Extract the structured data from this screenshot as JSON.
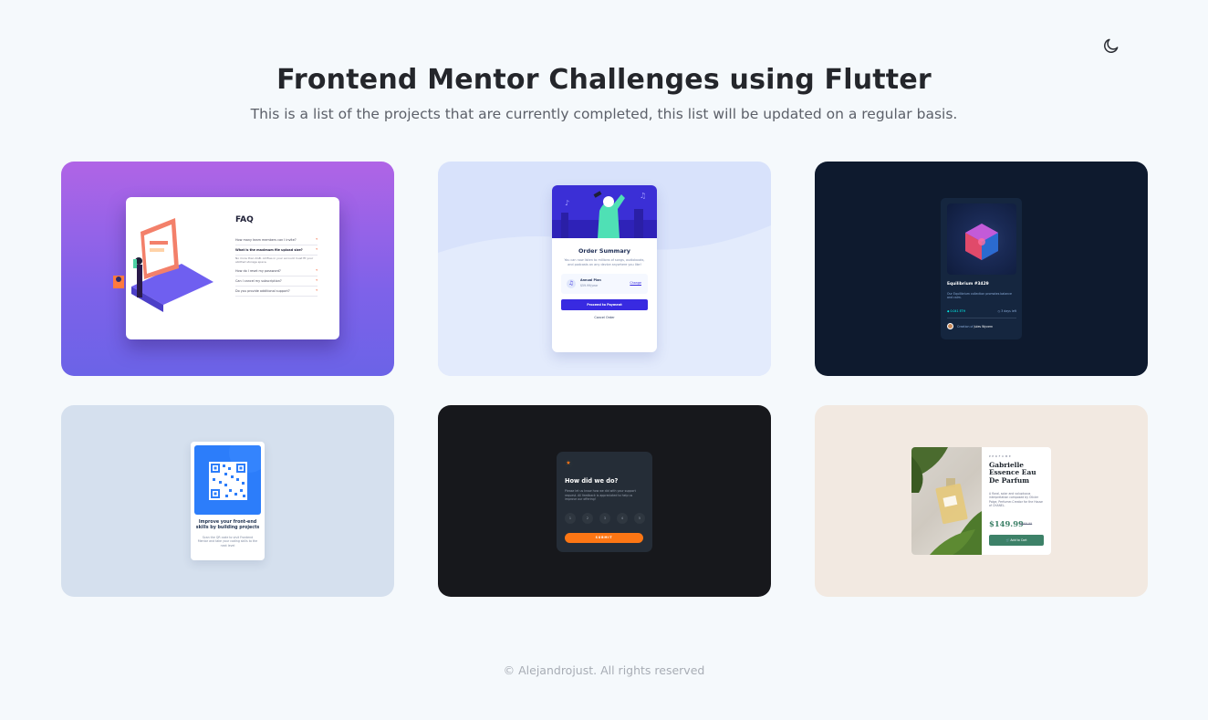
{
  "header": {
    "title": "Frontend Mentor Challenges using Flutter",
    "subtitle": "This is a list of the projects that are currently completed, this list will be updated on a regular basis."
  },
  "theme_toggle": {
    "icon": "moon-icon"
  },
  "projects": [
    {
      "id": "faq-accordion",
      "faq": {
        "title": "FAQ",
        "questions": [
          "How many team members can I invite?",
          "What is the maximum file upload size?",
          "How do I reset my password?",
          "Can I cancel my subscription?",
          "Do you provide additional support?"
        ],
        "answer": "No more than 2GB. All files in your account must fit your allotted storage space."
      }
    },
    {
      "id": "order-summary",
      "order": {
        "title": "Order Summary",
        "description": "You can now listen to millions of songs, audiobooks, and podcasts on any device anywhere you like!",
        "plan_name": "Annual Plan",
        "plan_price": "$59.99/year",
        "change": "Change",
        "pay": "Proceed to Payment",
        "cancel": "Cancel Order"
      }
    },
    {
      "id": "nft-preview",
      "nft": {
        "name": "Equilibrium #3429",
        "description": "Our Equilibrium collection promotes balance and calm.",
        "price": "0.041 ETH",
        "days": "3 days left",
        "creator_prefix": "Creation of",
        "creator": "Jules Wyvern"
      }
    },
    {
      "id": "qr-code",
      "qr": {
        "title": "Improve your front-end skills by building projects",
        "description": "Scan the QR code to visit Frontend Mentor and take your coding skills to the next level"
      }
    },
    {
      "id": "interactive-rating",
      "rating": {
        "title": "How did we do?",
        "description": "Please let us know how we did with your support request. All feedback is appreciated to help us improve our offering!",
        "numbers": [
          "1",
          "2",
          "3",
          "4",
          "5"
        ],
        "submit": "SUBMIT"
      }
    },
    {
      "id": "product-preview",
      "perfume": {
        "category": "PERFUME",
        "name": "Gabrielle Essence Eau De Parfum",
        "description": "A floral, solar and voluptuous interpretation composed by Olivier Polge, Perfumer-Creator for the House of CHANEL.",
        "price": "$149.99",
        "old_price": "$169.99",
        "button": "Add to Cart"
      }
    }
  ],
  "footer": {
    "text": "© Alejandrojust. All rights reserved"
  },
  "colors": {
    "background": "#f5f9fc",
    "title": "#24262b",
    "faq_gradient_top": "#b064e6",
    "order_bg": "#d8e2fb",
    "nft_bg": "#0e1a2e",
    "qr_bg": "#d5e0ee",
    "rating_bg": "#17181c",
    "perfume_bg": "#f2e9e1"
  }
}
